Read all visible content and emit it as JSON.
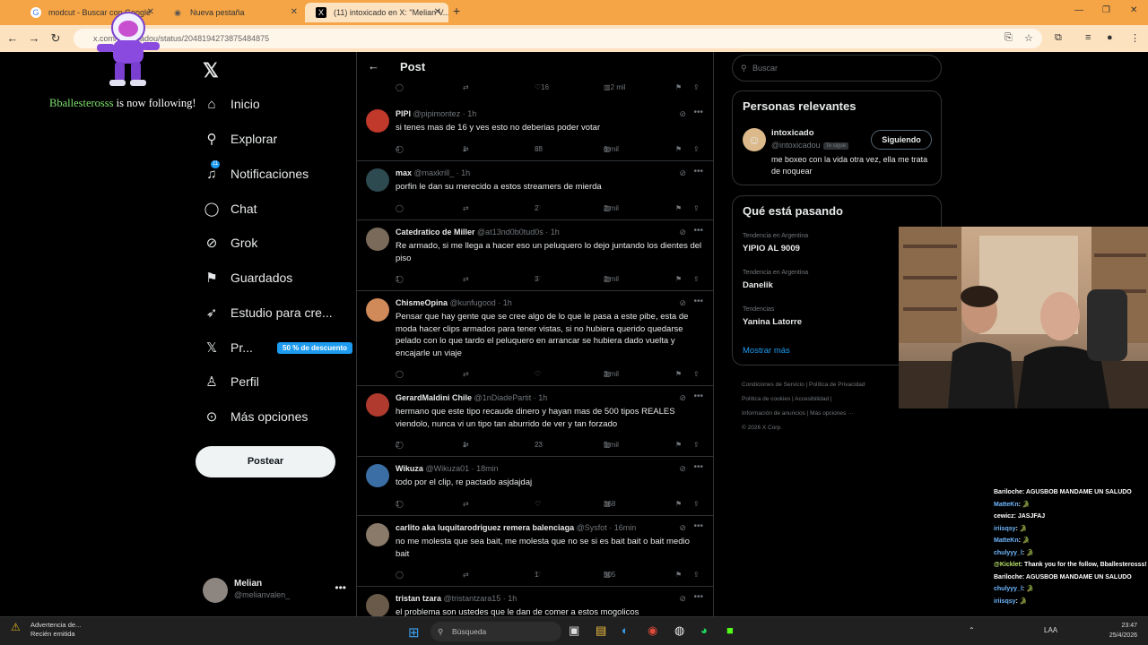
{
  "browser": {
    "tabs": [
      {
        "label": "modcut - Buscar con Google",
        "icon": "G"
      },
      {
        "label": "Nueva pestaña",
        "icon": "◉"
      },
      {
        "label": "(11) intoxicado en X: \"Melian V...",
        "icon": "X"
      }
    ],
    "url": "x.com/intoxicadou/status/2048194273875484875"
  },
  "nav": {
    "items": [
      {
        "label": "Inicio",
        "icon": "home-icon",
        "glyph": "⌂"
      },
      {
        "label": "Explorar",
        "icon": "search-icon",
        "glyph": "⚲"
      },
      {
        "label": "Notificaciones",
        "icon": "bell-icon",
        "glyph": "🔔"
      },
      {
        "label": "Chat",
        "icon": "chat-icon",
        "glyph": "◯"
      },
      {
        "label": "Grok",
        "icon": "grok-icon",
        "glyph": "⊘"
      },
      {
        "label": "Guardados",
        "icon": "bookmark-icon",
        "glyph": "⚑"
      },
      {
        "label": "Estudio para cre...",
        "icon": "rocket-icon",
        "glyph": "➶"
      },
      {
        "label": "Pr...",
        "icon": "x-premium-icon",
        "glyph": "𝕏"
      },
      {
        "label": "Perfil",
        "icon": "person-icon",
        "glyph": "♙"
      },
      {
        "label": "Más opciones",
        "icon": "more-icon",
        "glyph": "⊙"
      }
    ],
    "notif_badge": "11",
    "discount": "50 % de descuento",
    "post_button": "Postear",
    "account_name": "Melian",
    "account_handle": "@melianvalen_"
  },
  "feed": {
    "title": "Post",
    "top_actions": {
      "likes": "16",
      "views": "2 mil"
    },
    "tweets": [
      {
        "name": "PIPI",
        "handle": "@pipimontez",
        "time": "1h",
        "text": "si tenes mas de 16 y ves esto no deberias poder votar",
        "replies": "4",
        "retweets": "1",
        "likes": "88",
        "views": "6 mil",
        "avatar_color": "#c0392b"
      },
      {
        "name": "max",
        "handle": "@maxkrill_",
        "time": "1h",
        "text": "porfin le dan su merecido a estos streamers de mierda",
        "replies": "",
        "retweets": "",
        "likes": "2",
        "views": "2 mil",
        "avatar_color": "#2c4a50"
      },
      {
        "name": "Catedratico de Miller",
        "handle": "@at13nd0b0tud0s",
        "time": "1h",
        "text": "Re armado, si me llega a hacer eso un peluquero lo dejo juntando los dientes del piso",
        "replies": "1",
        "retweets": "",
        "likes": "3",
        "views": "2 mil",
        "avatar_color": "#7a6a5a"
      },
      {
        "name": "ChismeOpina",
        "handle": "@kunfugood",
        "time": "1h",
        "text": "Pensar que hay gente que se cree algo de lo que le pasa a este pibe, esta de moda hacer clips armados para tener vistas, si no hubiera querido quedarse pelado con lo que tardo el peluquero en arrancar se hubiera dado vuelta y encajarle un viaje",
        "replies": "",
        "retweets": "",
        "likes": "",
        "views": "3 mil",
        "avatar_color": "#d08a5a"
      },
      {
        "name": "GerardMaldini Chile",
        "handle": "@1nDiadePartit",
        "time": "1h",
        "text": "hermano que este tipo recaude dinero y hayan mas de 500 tipos REALES viendolo, nunca vi un tipo tan aburrido de ver y tan forzado",
        "replies": "2",
        "retweets": "1",
        "likes": "23",
        "views": "5 mil",
        "avatar_color": "#b03a2e"
      },
      {
        "name": "Wikuza",
        "handle": "@Wikuza01",
        "time": "18min",
        "text": "todo por el clip, re pactado asjdajdaj",
        "replies": "1",
        "retweets": "",
        "likes": "",
        "views": "368",
        "avatar_color": "#3a6ea5"
      },
      {
        "name": "carlito aka luquitarodriguez remera balenciaga",
        "handle": "@Sysfot",
        "time": "16min",
        "text": "no me molesta que sea bait, me molesta que no se si es bait bait o bait medio bait",
        "replies": "",
        "retweets": "",
        "likes": "1",
        "views": "505",
        "avatar_color": "#8a7a6a"
      },
      {
        "name": "tristan tzara",
        "handle": "@tristantzara15",
        "time": "1h",
        "text": "el problema son ustedes que le dan de comer a estos mogolicos",
        "replies": "",
        "retweets": "",
        "likes": "",
        "views": "",
        "avatar_color": "#6a5a4a"
      }
    ]
  },
  "right": {
    "search_placeholder": "Buscar",
    "relevant_title": "Personas relevantes",
    "relevant_name": "intoxicado",
    "relevant_handle": "@intoxicadou",
    "relevant_tag": "Te sigue",
    "relevant_button": "Siguiendo",
    "relevant_bio": "me boxeo con la vida otra vez, ella me trata de noquear",
    "trends_title": "Qué está pasando",
    "trends": [
      {
        "category": "Tendencia en Argentina",
        "name": "YIPIO AL 9009"
      },
      {
        "category": "Tendencia en Argentina",
        "name": "Danelik"
      },
      {
        "category": "Tendencias",
        "name": "Yanina Latorre"
      }
    ],
    "show_more": "Mostrar más",
    "footer": [
      "Condiciones de Servicio  |  Política de Privacidad",
      "Política de cookies  |  Accesibilidad  |",
      "Información de anuncios  |  Más opciones ···",
      "© 2026 X Corp."
    ]
  },
  "overlay": {
    "follow_user": "Bballesterosss",
    "follow_text": " is now following!",
    "chat": [
      {
        "user": "Bariloche",
        "msg": ": AGUSBOB MANDAME UN SALUDO"
      },
      {
        "user": "MatteKn",
        "msg": ": 🐊"
      },
      {
        "user": "cewicz",
        "msg": ": JASJFAJ"
      },
      {
        "user": "iriisqsy",
        "msg": ": 🐊"
      },
      {
        "user": "MatteKn",
        "msg": ": 🐊"
      },
      {
        "user": "chulyyy_l",
        "msg": ": 🐊"
      },
      {
        "user": "@Kicklet",
        "msg": ": Thank you for the follow, Bballesterosss!"
      },
      {
        "user": "Bariloche",
        "msg": ": AGUSBOB MANDAME UN SALUDO"
      },
      {
        "user": "chulyyy_l",
        "msg": ": 🐊"
      },
      {
        "user": "iriisqsy",
        "msg": ": 🐊"
      }
    ]
  },
  "taskbar": {
    "warning_title": "Advertencia de...",
    "warning_sub": "Recién emitida",
    "search": "Búsqueda",
    "lang": "LAA",
    "time": "23:47",
    "date": "25/4/2026"
  }
}
